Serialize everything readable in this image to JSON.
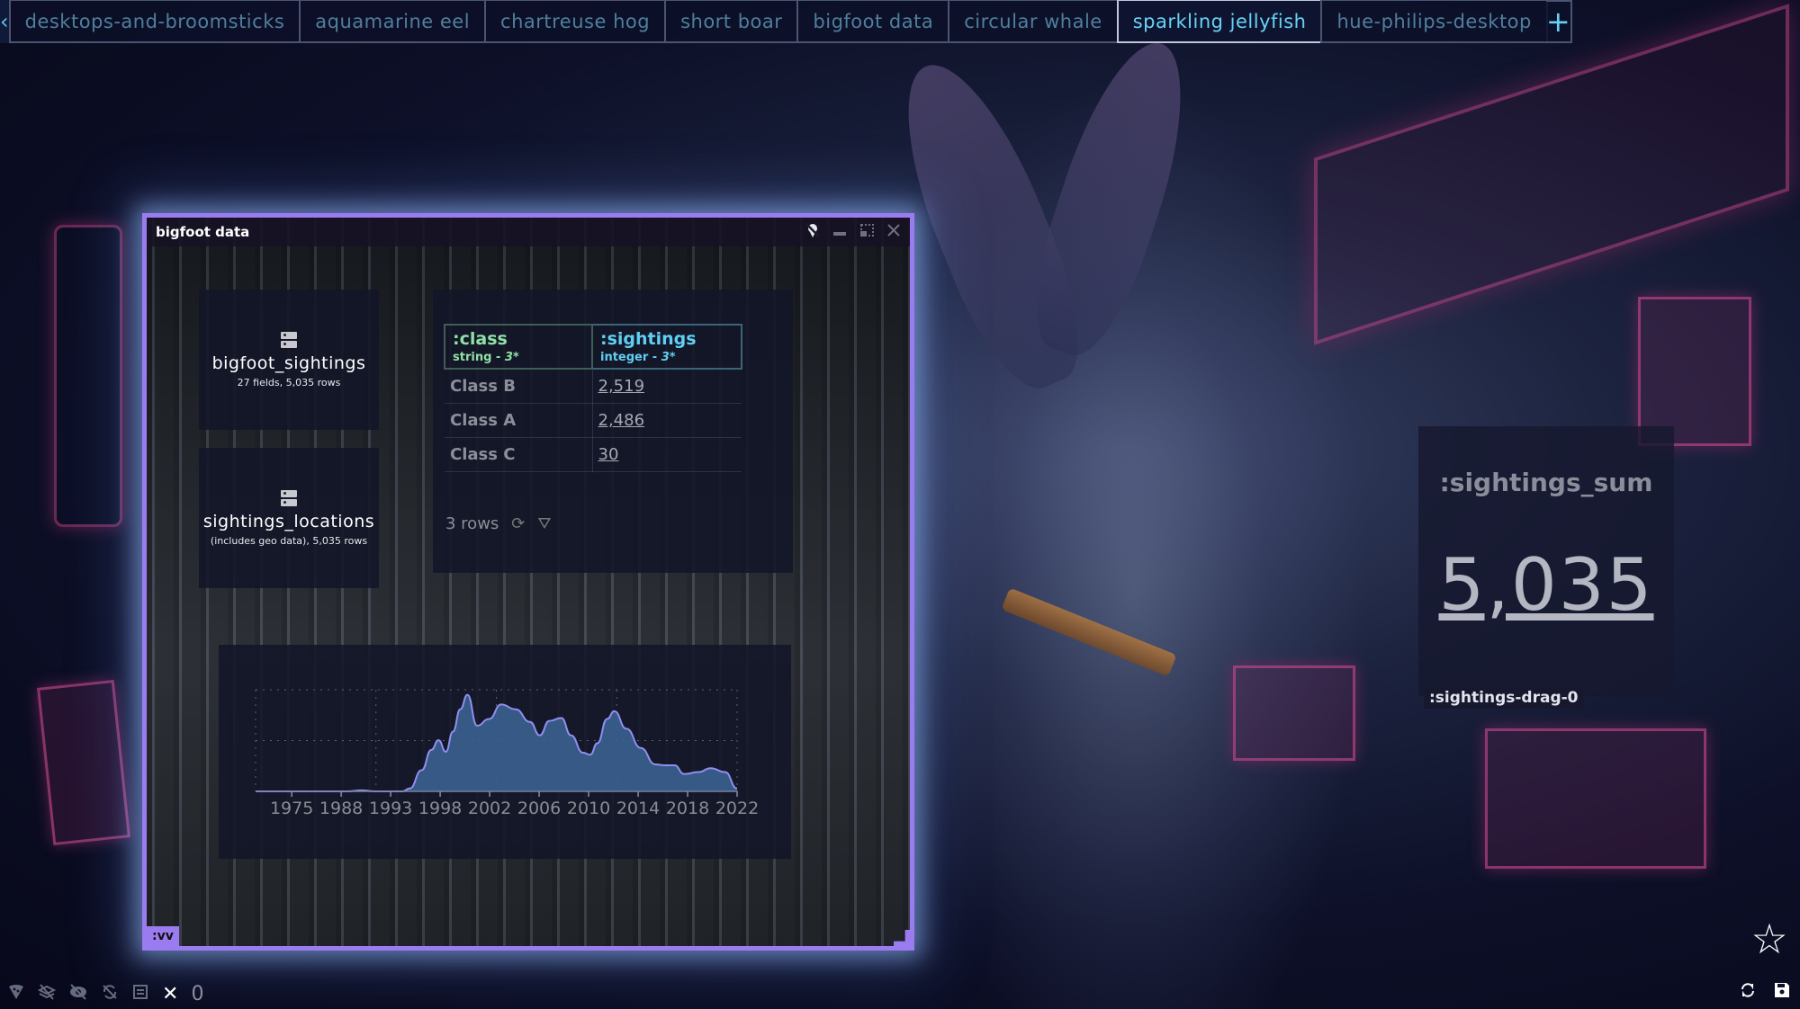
{
  "tabs": {
    "back_icon": "‹",
    "items": [
      {
        "label": "desktops-and-broomsticks",
        "active": false
      },
      {
        "label": "aquamarine eel",
        "active": false
      },
      {
        "label": "chartreuse hog",
        "active": false
      },
      {
        "label": "short boar",
        "active": false
      },
      {
        "label": "bigfoot data",
        "active": false
      },
      {
        "label": "circular whale",
        "active": false
      },
      {
        "label": "sparkling jellyfish",
        "active": true
      },
      {
        "label": "hue-philips-desktop",
        "active": false
      }
    ],
    "add_icon": "+"
  },
  "window": {
    "title": "bigfoot data",
    "footer_tag": ":vv",
    "controls": {
      "pin": "pin-off-icon",
      "minimize": "minimize-icon",
      "maximize": "maximize-icon",
      "close": "close-icon"
    }
  },
  "datasets": [
    {
      "name": "bigfoot_sightings",
      "subtitle": "27 fields, 5,035 rows"
    },
    {
      "name": "sightings_locations",
      "subtitle": "(includes geo data), 5,035 rows"
    }
  ],
  "table": {
    "columns": [
      {
        "name": ":class",
        "type": "string - ",
        "count": "3*"
      },
      {
        "name": ":sightings",
        "type": "integer - ",
        "count": "3*"
      }
    ],
    "rows": [
      {
        "class": "Class B",
        "sightings": "2,519"
      },
      {
        "class": "Class A",
        "sightings": "2,486"
      },
      {
        "class": "Class C",
        "sightings": "30"
      }
    ],
    "footer": {
      "row_count": "3 rows",
      "refresh_icon": "⟳",
      "shapes_icon": "⛛"
    }
  },
  "chart_data": {
    "type": "area",
    "title": "",
    "xlabel": "",
    "ylabel": "",
    "tick_labels": [
      "1975",
      "1988",
      "1993",
      "1998",
      "2002",
      "2006",
      "2010",
      "2014",
      "2018",
      "2022"
    ],
    "grid": true,
    "legend": "none",
    "colors": {
      "line": "#8f8ff0",
      "fill": "#3a6090"
    },
    "note": "relative density of sightings over time; x in axis fraction 0-1, y in fraction of max",
    "points": [
      [
        0.0,
        0.0
      ],
      [
        0.08,
        0.0
      ],
      [
        0.14,
        0.0
      ],
      [
        0.19,
        0.0
      ],
      [
        0.22,
        0.01
      ],
      [
        0.25,
        0.0
      ],
      [
        0.29,
        0.0
      ],
      [
        0.305,
        0.0
      ],
      [
        0.32,
        0.03
      ],
      [
        0.345,
        0.22
      ],
      [
        0.365,
        0.43
      ],
      [
        0.38,
        0.53
      ],
      [
        0.395,
        0.41
      ],
      [
        0.41,
        0.62
      ],
      [
        0.425,
        0.85
      ],
      [
        0.44,
        1.0
      ],
      [
        0.46,
        0.68
      ],
      [
        0.485,
        0.75
      ],
      [
        0.51,
        0.9
      ],
      [
        0.54,
        0.85
      ],
      [
        0.57,
        0.72
      ],
      [
        0.59,
        0.58
      ],
      [
        0.61,
        0.73
      ],
      [
        0.635,
        0.76
      ],
      [
        0.655,
        0.58
      ],
      [
        0.68,
        0.4
      ],
      [
        0.695,
        0.38
      ],
      [
        0.71,
        0.5
      ],
      [
        0.73,
        0.75
      ],
      [
        0.745,
        0.83
      ],
      [
        0.77,
        0.65
      ],
      [
        0.8,
        0.45
      ],
      [
        0.83,
        0.28
      ],
      [
        0.85,
        0.27
      ],
      [
        0.87,
        0.27
      ],
      [
        0.89,
        0.18
      ],
      [
        0.92,
        0.2
      ],
      [
        0.945,
        0.24
      ],
      [
        0.975,
        0.2
      ],
      [
        1.0,
        0.03
      ]
    ]
  },
  "sum_widget": {
    "label": ":sightings_sum",
    "value": "5,035",
    "tag": ":sightings-drag-0"
  },
  "status_bar": {
    "icons": [
      "pizza-icon",
      "layers-off-icon",
      "eye-off-icon",
      "sync-off-icon",
      "notes-icon"
    ],
    "close_label": "✕",
    "count": "0"
  },
  "corner": {
    "star_icon": "☆",
    "refresh_icon": "⟳",
    "save_icon": "💾"
  }
}
